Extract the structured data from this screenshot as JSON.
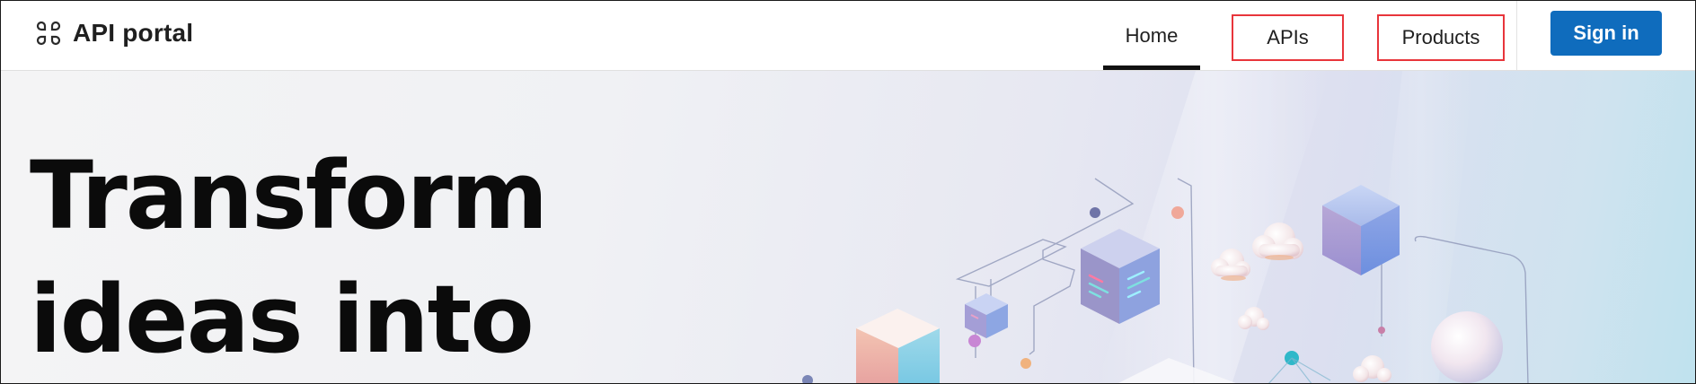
{
  "header": {
    "brand": "API portal",
    "logo_icon": "four-leaf-grid-icon",
    "nav": [
      {
        "label": "Home",
        "active": true
      },
      {
        "label": "APIs",
        "active": false
      },
      {
        "label": "Products",
        "active": false
      }
    ],
    "sign_in_label": "Sign in",
    "accent_color": "#0f6cbd",
    "highlight_color": "#e8353b"
  },
  "hero": {
    "title_line1": "Transform",
    "title_line2": "ideas into",
    "illustration": "isometric-cubes-clouds-network-illustration"
  }
}
